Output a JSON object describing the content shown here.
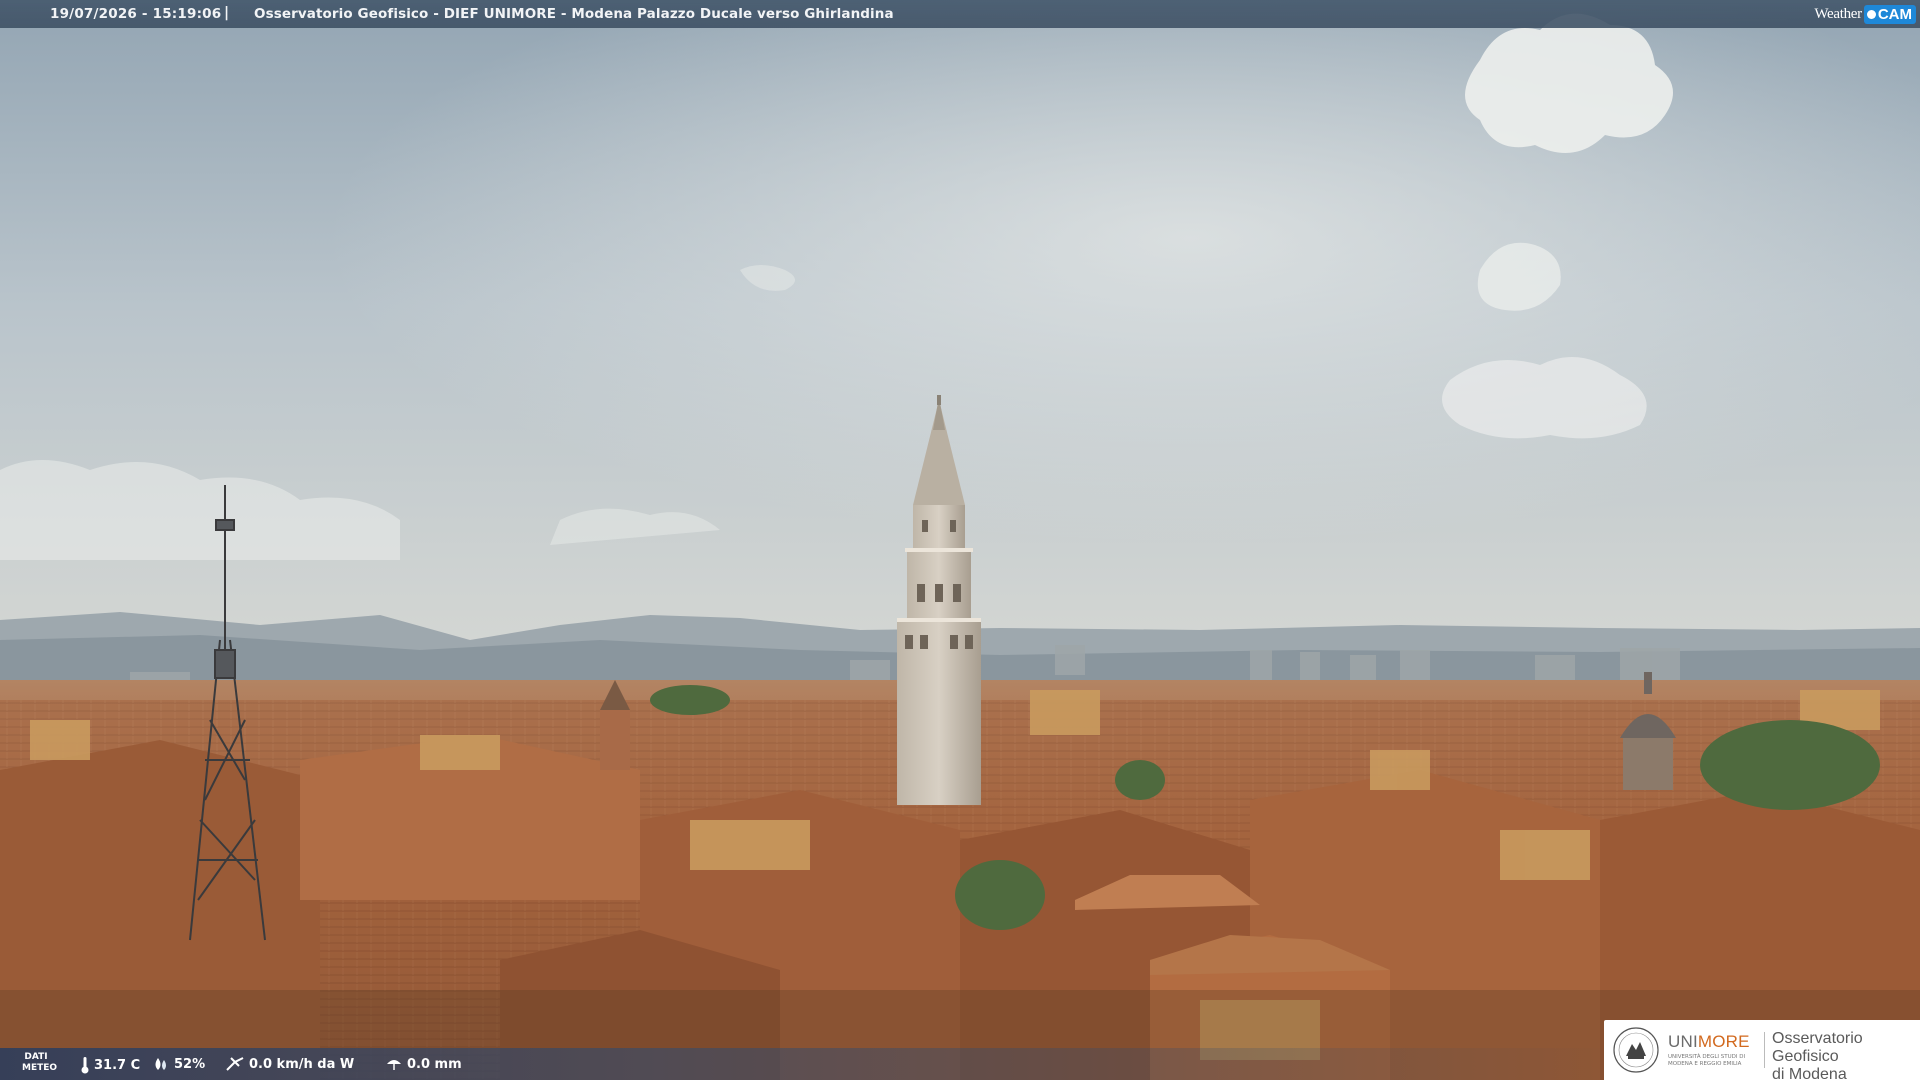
{
  "topbar": {
    "timestamp": "19/07/2026 - 15:19:06",
    "separator": "|",
    "title": "Osservatorio Geofisico - DIEF UNIMORE - Modena Palazzo Ducale verso Ghirlandina",
    "logo_weather": "Weather",
    "logo_cam": "CAM"
  },
  "meteo": {
    "label": "DATI METEO",
    "temperature": "31.7 C",
    "humidity": "52%",
    "wind": "0.0 km/h da W",
    "rain": "0.0 mm",
    "icons": [
      "thermometer-icon",
      "humidity-icon",
      "wind-icon",
      "rain-icon"
    ]
  },
  "institution": {
    "brand_prefix": "UNI",
    "brand_suffix": "MORE",
    "brand_sub": "UNIVERSITÀ DEGLI STUDI DI MODENA E REGGIO EMILIA",
    "observatory_line1": "Osservatorio Geofisico",
    "observatory_line2": "di Modena"
  },
  "colors": {
    "sky_top": "#9fb0bd",
    "sky_bottom": "#d9dcda",
    "roofs": "#a0603a",
    "tower": "#c9c1b5",
    "brand_orange": "#d2691e",
    "cam_blue": "#1e88d8"
  }
}
